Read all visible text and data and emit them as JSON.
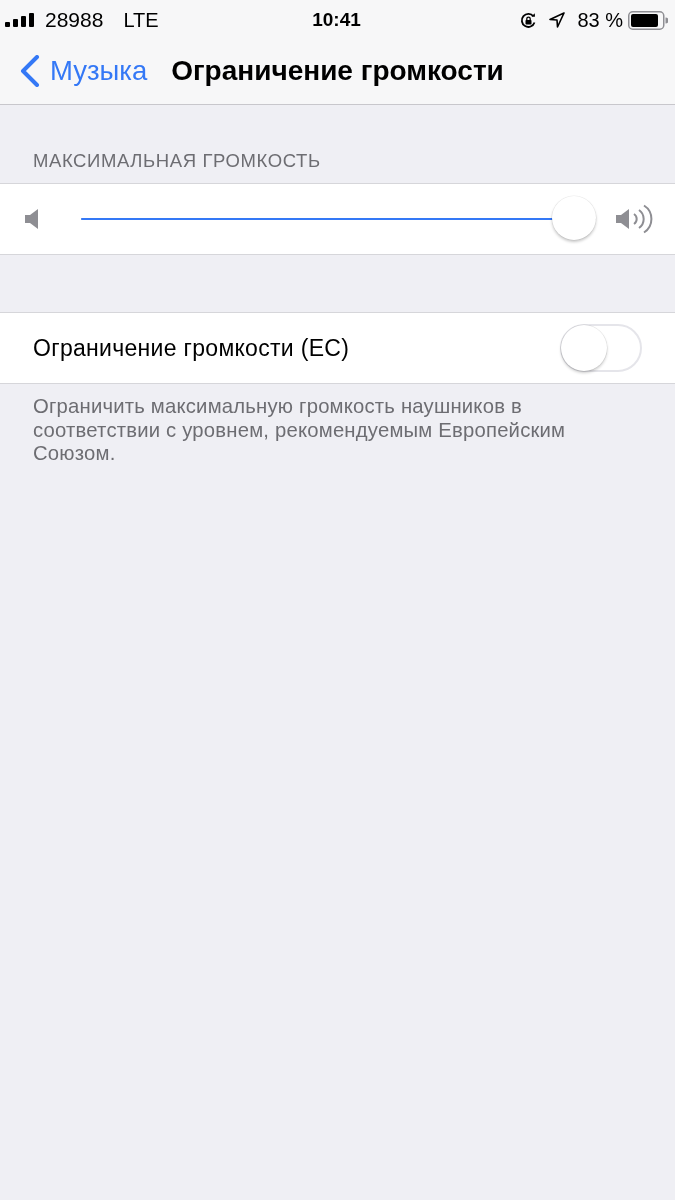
{
  "status_bar": {
    "carrier": "28988",
    "network": "LTE",
    "time": "10:41",
    "battery": "83 %"
  },
  "nav": {
    "back": "Музыка",
    "title": "Ограничение громкости"
  },
  "volume": {
    "header": "МАКСИМАЛЬНАЯ ГРОМКОСТЬ",
    "level": 1
  },
  "eu_limit": {
    "label": "Ограничение громкости (ЕС)",
    "on": false,
    "footer": "Ограничить максимальную громкость наушников в соответствии с уровнем, рекомендуемым Европейским Союзом."
  }
}
